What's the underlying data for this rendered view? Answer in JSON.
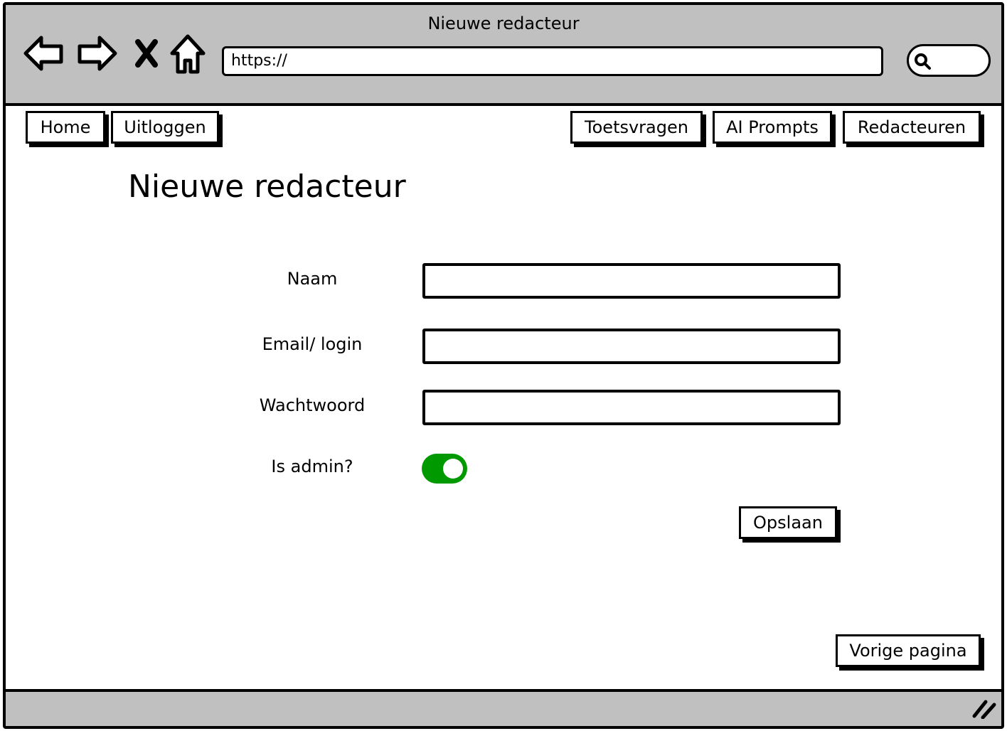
{
  "window": {
    "title": "Nieuwe redacteur"
  },
  "browser": {
    "url": "https://",
    "icons": [
      "back-arrow-icon",
      "forward-arrow-icon",
      "close-icon",
      "home-icon",
      "search-icon",
      "resize-handle-icon"
    ]
  },
  "nav": {
    "left": [
      {
        "label": "Home"
      },
      {
        "label": "Uitloggen"
      }
    ],
    "right": [
      {
        "label": "Toetsvragen"
      },
      {
        "label": "AI Prompts"
      },
      {
        "label": "Redacteuren"
      }
    ]
  },
  "page": {
    "title": "Nieuwe redacteur"
  },
  "form": {
    "name_label": "Naam",
    "name_value": "",
    "email_label": "Email/ login",
    "email_value": "",
    "password_label": "Wachtwoord",
    "password_value": "",
    "admin_label": "Is admin?",
    "admin_on": true,
    "save_label": "Opslaan"
  },
  "footer": {
    "back_label": "Vorige pagina"
  },
  "colors": {
    "chrome": "#c0c0c0",
    "toggle_on": "#009900"
  }
}
